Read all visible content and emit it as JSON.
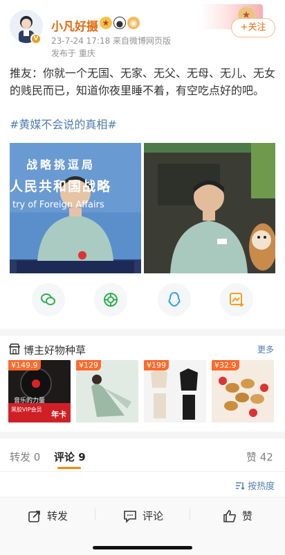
{
  "header": {
    "username": "小凡好摄",
    "time_source": "23-7-24 17:18  来自微博网页版",
    "location": "发布于 重庆",
    "follow_label": "+关注"
  },
  "post": {
    "text": "推友：你就一个无国、无家、无父、无母、无儿、无女的贱民而已，知道你夜里睡不着，有空吃点好的吧。",
    "hashtag": "#黄媒不会说的真相#",
    "image1_sign_line1": "战略挑逗局",
    "image1_sign_line2": "人民共和国战略",
    "image1_sign_line3": "try of Foreign Affairs"
  },
  "share_icons": [
    "wechat-icon",
    "moments-icon",
    "qq-icon",
    "save-image-icon"
  ],
  "shop": {
    "title": "博主好物种草",
    "more_label": "更多",
    "products": [
      {
        "price": "¥149.9",
        "caption1": "音乐的力量",
        "caption2": "黑胶VIP会员",
        "caption3": "年卡"
      },
      {
        "price": "¥129"
      },
      {
        "price": "¥199"
      },
      {
        "price": "¥32.9"
      }
    ]
  },
  "tabs": {
    "repost": "转发 0",
    "comment": "评论 9",
    "like": "赞 42",
    "sort_label": "按热度"
  },
  "bottom_bar": {
    "repost": "转发",
    "comment": "评论",
    "like": "赞"
  },
  "colors": {
    "accent": "#ff8200",
    "username": "#e7690f",
    "link": "#507daf",
    "price_tag": "#ff6a2b"
  }
}
